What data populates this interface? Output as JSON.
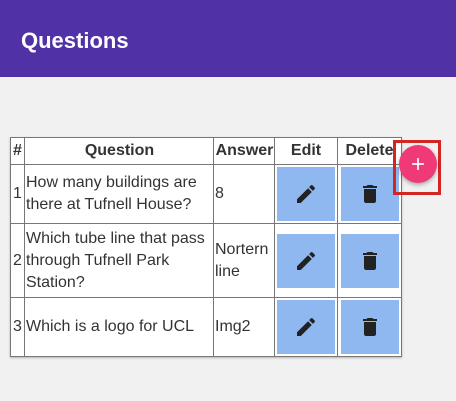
{
  "appbar": {
    "title": "Questions"
  },
  "colors": {
    "appbar": "#5131a6",
    "action_button": "#8fb8f0",
    "fab": "#f03a78",
    "highlight": "#d42525"
  },
  "table": {
    "headers": {
      "num": "#",
      "question": "Question",
      "answer": "Answer",
      "edit": "Edit",
      "delete": "Delete"
    },
    "rows": [
      {
        "num": "1",
        "question": "How many buildings are there at Tufnell House?",
        "answer": "8"
      },
      {
        "num": "2",
        "question": "Which tube line that pass through Tufnell Park Station?",
        "answer": "Nortern line"
      },
      {
        "num": "3",
        "question": "Which is a logo for UCL",
        "answer": "Img2"
      }
    ],
    "edit_icon": "pencil-icon",
    "delete_icon": "trash-icon"
  },
  "fab": {
    "icon": "plus-icon"
  }
}
